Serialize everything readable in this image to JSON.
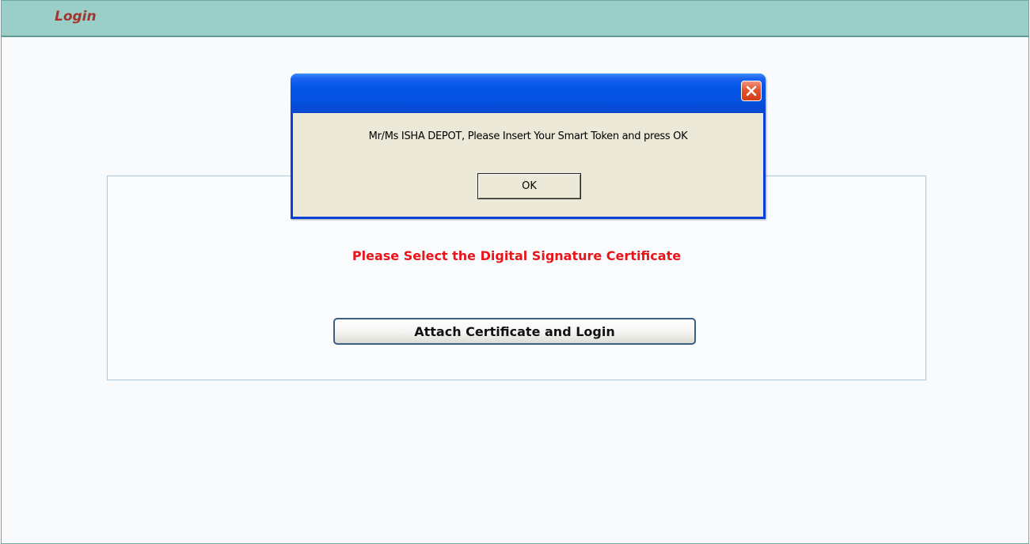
{
  "header": {
    "title": "Login"
  },
  "main": {
    "prompt": "Please Select the Digital Signature Certificate",
    "attach_button_label": "Attach Certificate and Login"
  },
  "dialog": {
    "title": "",
    "message": "Mr/Ms ISHA  DEPOT, Please Insert Your Smart Token and press OK",
    "ok_label": "OK",
    "close_icon": "close-icon"
  },
  "colors": {
    "header_bg": "#99cfc8",
    "header_title": "#a4342e",
    "prompt_text": "#e8151b",
    "dialog_titlebar": "#0455e6",
    "dialog_body": "#ece9d8",
    "close_button": "#e3542f"
  }
}
